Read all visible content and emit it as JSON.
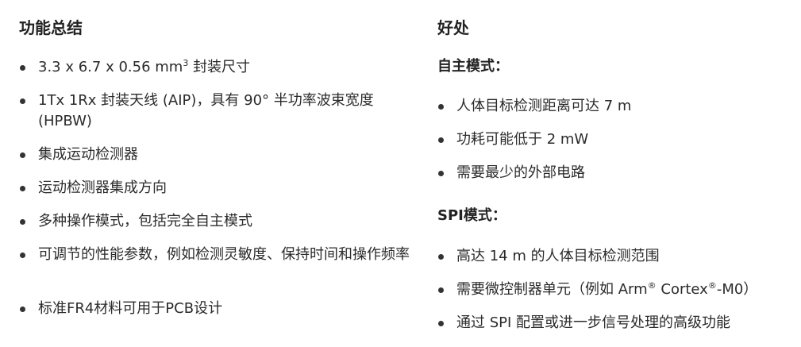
{
  "left": {
    "heading": "功能总结",
    "items": [
      {
        "pre": "3.3 x 6.7 x 0.56 mm",
        "sup": "3",
        "post": " 封装尺寸"
      },
      {
        "text": "1Tx 1Rx 封装天线 (AIP)，具有 90° 半功率波束宽度 (HPBW)"
      },
      {
        "text": "集成运动检测器"
      },
      {
        "text": "运动检测器集成方向"
      },
      {
        "text": "多种操作模式，包括完全自主模式"
      },
      {
        "text": "可调节的性能参数，例如检测灵敏度、保持时间和操作频率"
      },
      {
        "text": "标准FR4材料可用于PCB设计"
      }
    ]
  },
  "right": {
    "heading": "好处",
    "autonomous": {
      "title": "自主模式：",
      "items": [
        "人体目标检测距离可达 7 m",
        "功耗可能低于 2 mW",
        "需要最少的外部电路"
      ]
    },
    "spi": {
      "title": "SPI模式：",
      "items": [
        {
          "text": "高达 14 m 的人体目标检测范围"
        },
        {
          "pre": "需要微控制器单元（例如 Arm",
          "sup1": "®",
          "mid": " Cortex",
          "sup2": "®",
          "post": "-M0）"
        },
        {
          "text": "通过 SPI 配置或进一步信号处理的高级功能"
        }
      ]
    }
  }
}
